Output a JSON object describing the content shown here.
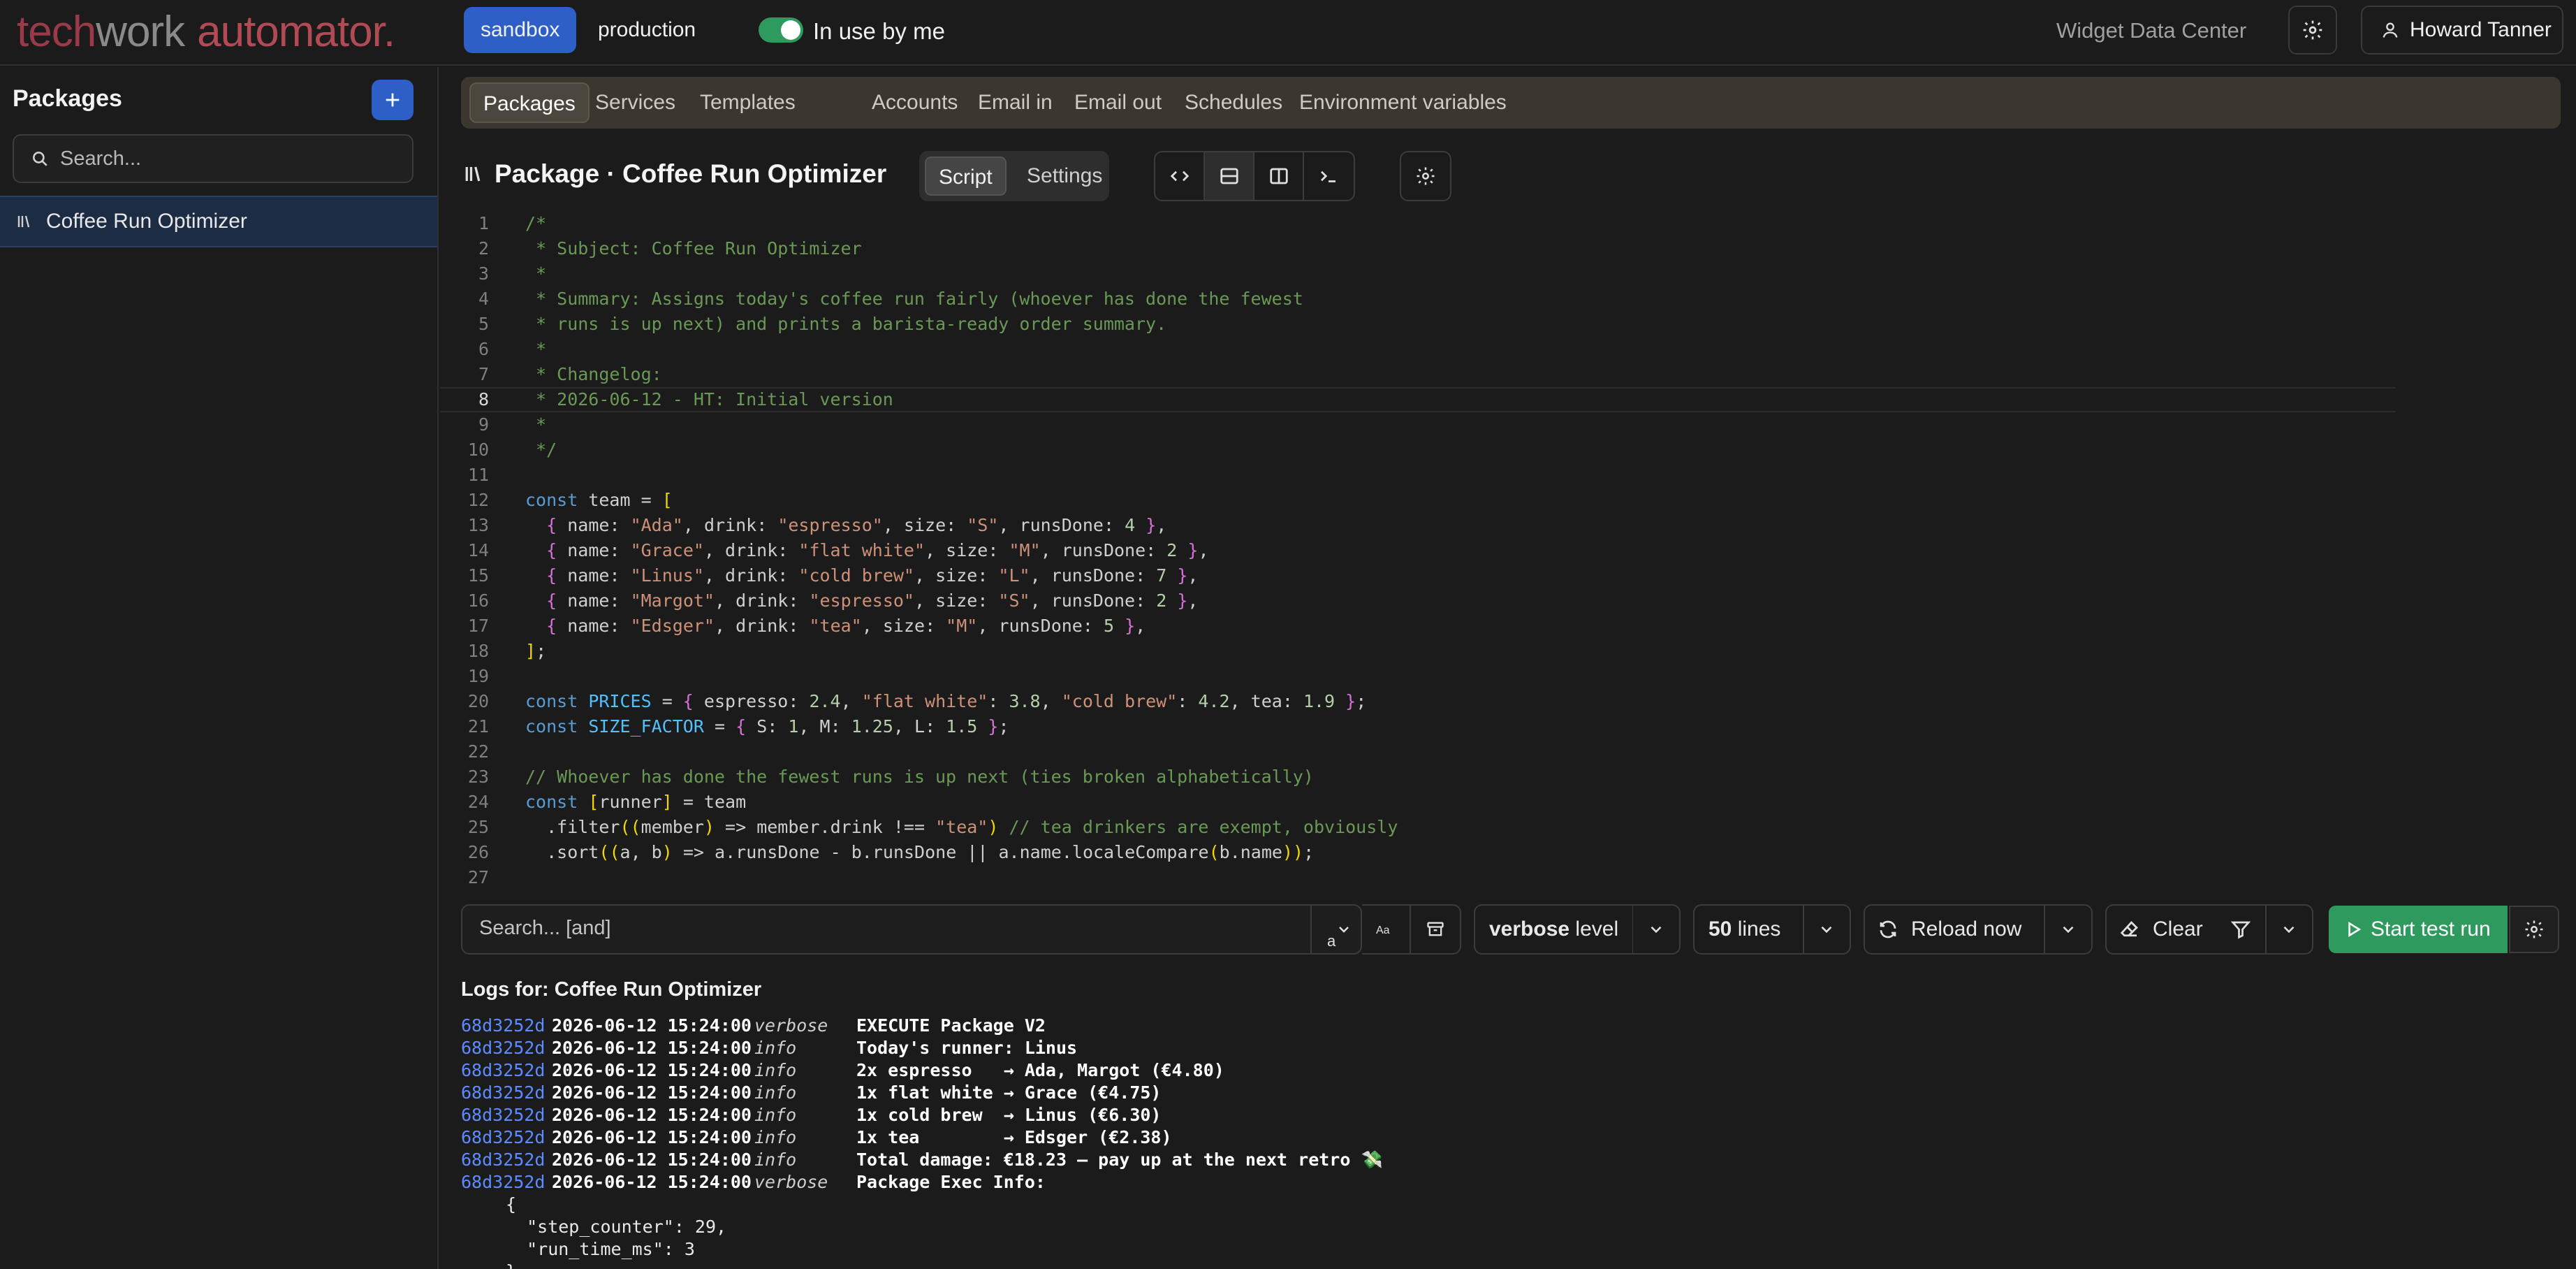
{
  "app": {
    "logo_part1": "tech",
    "logo_part2": "work",
    "logo_part3": "automator.",
    "environments": [
      "sandbox",
      "production"
    ],
    "active_environment": "sandbox",
    "in_use_toggle_label": "In use by me",
    "in_use_toggle_on": true,
    "workspace_name": "Widget Data Center",
    "user_name": "Howard Tanner"
  },
  "sidebar": {
    "title": "Packages",
    "search_placeholder": "Search...",
    "items": [
      {
        "label": "Coffee Run Optimizer",
        "selected": true
      }
    ]
  },
  "nav": {
    "tabs": [
      "Packages",
      "Services",
      "Templates",
      "Accounts",
      "Email in",
      "Email out",
      "Schedules",
      "Environment variables"
    ],
    "active": "Packages"
  },
  "package": {
    "title": "Package · Coffee Run Optimizer",
    "mode_tabs": [
      "Script",
      "Settings"
    ],
    "active_mode": "Script"
  },
  "editor": {
    "current_line": 8,
    "lines": [
      "/*",
      " * Subject: Coffee Run Optimizer",
      " *",
      " * Summary: Assigns today's coffee run fairly (whoever has done the fewest",
      " * runs is up next) and prints a barista-ready order summary.",
      " *",
      " * Changelog:",
      " * 2026-06-12 - HT: Initial version",
      " *",
      " */",
      "",
      "const team = [",
      "  { name: \"Ada\", drink: \"espresso\", size: \"S\", runsDone: 4 },",
      "  { name: \"Grace\", drink: \"flat white\", size: \"M\", runsDone: 2 },",
      "  { name: \"Linus\", drink: \"cold brew\", size: \"L\", runsDone: 7 },",
      "  { name: \"Margot\", drink: \"espresso\", size: \"S\", runsDone: 2 },",
      "  { name: \"Edsger\", drink: \"tea\", size: \"M\", runsDone: 5 },",
      "];",
      "",
      "const PRICES = { espresso: 2.4, \"flat white\": 3.8, \"cold brew\": 4.2, tea: 1.9 };",
      "const SIZE_FACTOR = { S: 1, M: 1.25, L: 1.5 };",
      "",
      "// Whoever has done the fewest runs is up next (ties broken alphabetically)",
      "const [runner] = team",
      "  .filter((member) => member.drink !== \"tea\") // tea drinkers are exempt, obviously",
      "  .sort((a, b) => a.runsDone - b.runsDone || a.name.localeCompare(b.name));",
      ""
    ]
  },
  "log_toolbar": {
    "search_placeholder": "Search... [and]",
    "regex_label": "a",
    "level_value": "verbose",
    "level_suffix": "level",
    "lines_value": "50",
    "lines_suffix": "lines",
    "reload_label": "Reload now",
    "clear_label": "Clear",
    "start_label": "Start test run"
  },
  "logs": {
    "title": "Logs for: Coffee Run Optimizer",
    "entries": [
      {
        "id": "68d3252d",
        "timestamp": "2026-06-12 15:24:00",
        "level": "verbose",
        "message": "EXECUTE Package V2"
      },
      {
        "id": "68d3252d",
        "timestamp": "2026-06-12 15:24:00",
        "level": "info",
        "message": "Today's runner: Linus"
      },
      {
        "id": "68d3252d",
        "timestamp": "2026-06-12 15:24:00",
        "level": "info",
        "message": "2x espresso   → Ada, Margot (€4.80)"
      },
      {
        "id": "68d3252d",
        "timestamp": "2026-06-12 15:24:00",
        "level": "info",
        "message": "1x flat white → Grace (€4.75)"
      },
      {
        "id": "68d3252d",
        "timestamp": "2026-06-12 15:24:00",
        "level": "info",
        "message": "1x cold brew  → Linus (€6.30)"
      },
      {
        "id": "68d3252d",
        "timestamp": "2026-06-12 15:24:00",
        "level": "info",
        "message": "1x tea        → Edsger (€2.38)"
      },
      {
        "id": "68d3252d",
        "timestamp": "2026-06-12 15:24:00",
        "level": "info",
        "message": "Total damage: €18.23 — pay up at the next retro 💸"
      },
      {
        "id": "68d3252d",
        "timestamp": "2026-06-12 15:24:00",
        "level": "verbose",
        "message": "Package Exec Info:"
      }
    ],
    "exec_info_lines": [
      "{",
      "  \"step_counter\": 29,",
      "  \"run_time_ms\": 3",
      "}"
    ]
  }
}
